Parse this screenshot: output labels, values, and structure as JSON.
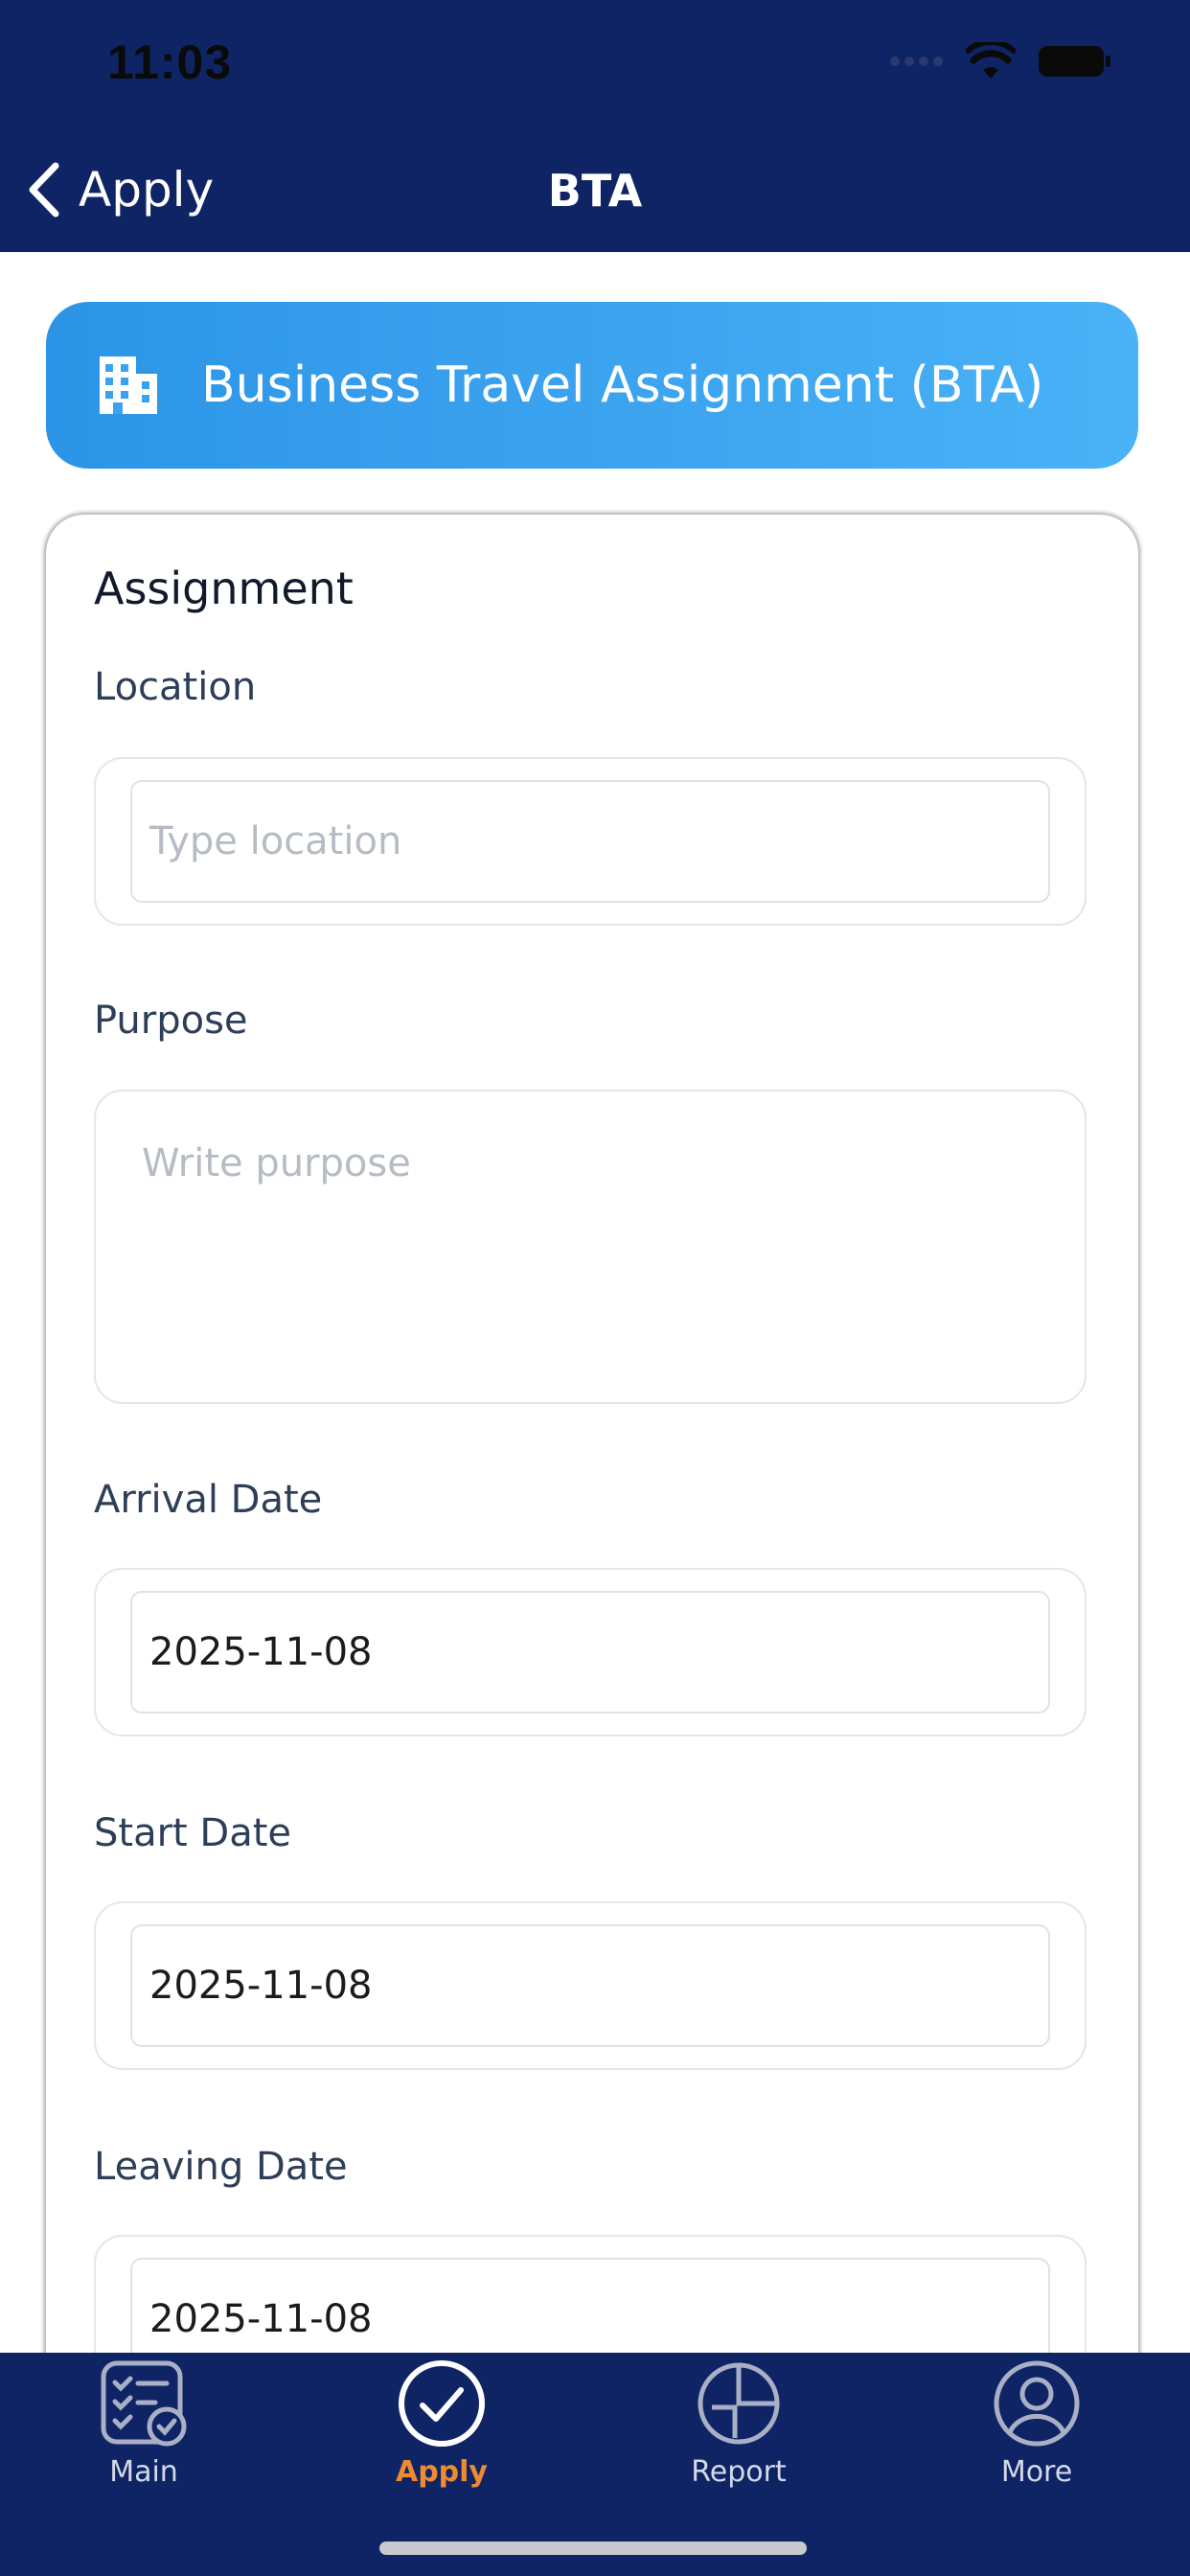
{
  "status_bar": {
    "time": "11:03"
  },
  "nav": {
    "back_label": "Apply",
    "title": "BTA"
  },
  "header": {
    "title": "Business Travel Assignment (BTA)"
  },
  "form": {
    "section_title": "Assignment",
    "location": {
      "label": "Location",
      "placeholder": "Type location",
      "value": ""
    },
    "purpose": {
      "label": "Purpose",
      "placeholder": "Write purpose",
      "value": ""
    },
    "arrival_date": {
      "label": "Arrival Date",
      "value": "2025-11-08"
    },
    "start_date": {
      "label": "Start Date",
      "value": "2025-11-08"
    },
    "leaving_date": {
      "label": "Leaving Date",
      "value": "2025-11-08"
    }
  },
  "tabs": [
    {
      "label": "Main",
      "icon": "checklist-icon",
      "active": false
    },
    {
      "label": "Apply",
      "icon": "check-circle-icon",
      "active": true
    },
    {
      "label": "Report",
      "icon": "chart-circle-icon",
      "active": false
    },
    {
      "label": "More",
      "icon": "user-circle-icon",
      "active": false
    }
  ],
  "colors": {
    "navy": "#0f2465",
    "header_gradient_start": "#2c94e6",
    "header_gradient_end": "#4ab2f7",
    "active_tab": "#f08a30"
  }
}
